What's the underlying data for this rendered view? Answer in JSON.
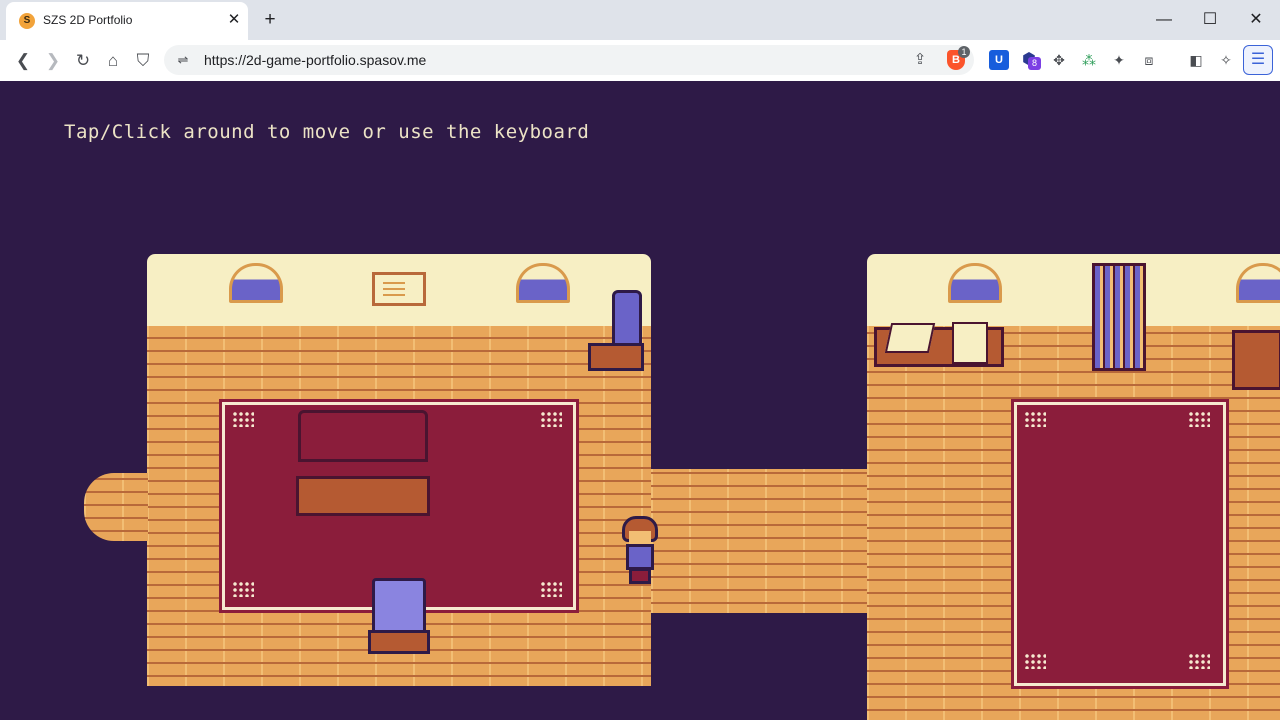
{
  "browser": {
    "tab": {
      "title": "SZS 2D Portfolio",
      "favicon_glyph": "S",
      "close_glyph": "✕"
    },
    "new_tab_glyph": "+",
    "window_controls": {
      "minimize": "—",
      "maximize": "☐",
      "close": "✕"
    },
    "toolbar": {
      "back": "❮",
      "forward": "❯",
      "reload": "↻",
      "home": "⌂",
      "bookmark": "⛉",
      "site_info": "⇌",
      "url": "https://2d-game-portfolio.spasov.me",
      "share": "⇪",
      "brave_shield_glyph": "B",
      "brave_shield_badge": "1",
      "extensions": [
        {
          "name": "bitwarden-icon",
          "glyph": "U"
        },
        {
          "name": "education-extension-icon",
          "glyph": "⬢"
        },
        {
          "name": "move-extension-icon",
          "glyph": "✥"
        },
        {
          "name": "tree-extension-icon",
          "glyph": "⁂"
        },
        {
          "name": "puzzle-icon",
          "glyph": "✦"
        },
        {
          "name": "screenshot-icon",
          "glyph": "⧈"
        },
        {
          "name": "sidebar-icon",
          "glyph": "◧"
        },
        {
          "name": "leo-ai-icon",
          "glyph": "✧"
        }
      ],
      "extension_badge": "8",
      "menu_glyph": "☰"
    }
  },
  "game": {
    "instructions": "Tap/Click around to move or use the keyboard",
    "colors": {
      "background": "#2e1a47",
      "wall": "#f7efc4",
      "floor": "#e8a65a",
      "rug": "#8b1d3b",
      "accent_purple": "#6a63c8"
    }
  }
}
